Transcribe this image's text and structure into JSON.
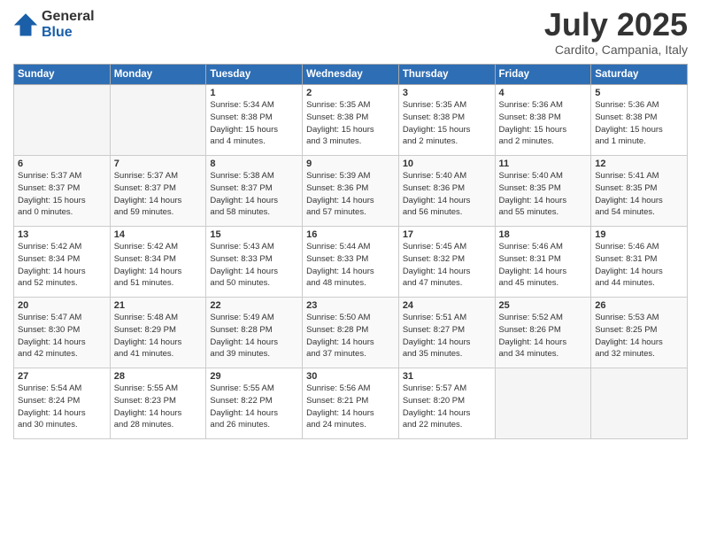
{
  "logo": {
    "general": "General",
    "blue": "Blue"
  },
  "title": "July 2025",
  "location": "Cardito, Campania, Italy",
  "weekdays": [
    "Sunday",
    "Monday",
    "Tuesday",
    "Wednesday",
    "Thursday",
    "Friday",
    "Saturday"
  ],
  "weeks": [
    [
      {
        "day": "",
        "info": ""
      },
      {
        "day": "",
        "info": ""
      },
      {
        "day": "1",
        "info": "Sunrise: 5:34 AM\nSunset: 8:38 PM\nDaylight: 15 hours\nand 4 minutes."
      },
      {
        "day": "2",
        "info": "Sunrise: 5:35 AM\nSunset: 8:38 PM\nDaylight: 15 hours\nand 3 minutes."
      },
      {
        "day": "3",
        "info": "Sunrise: 5:35 AM\nSunset: 8:38 PM\nDaylight: 15 hours\nand 2 minutes."
      },
      {
        "day": "4",
        "info": "Sunrise: 5:36 AM\nSunset: 8:38 PM\nDaylight: 15 hours\nand 2 minutes."
      },
      {
        "day": "5",
        "info": "Sunrise: 5:36 AM\nSunset: 8:38 PM\nDaylight: 15 hours\nand 1 minute."
      }
    ],
    [
      {
        "day": "6",
        "info": "Sunrise: 5:37 AM\nSunset: 8:37 PM\nDaylight: 15 hours\nand 0 minutes."
      },
      {
        "day": "7",
        "info": "Sunrise: 5:37 AM\nSunset: 8:37 PM\nDaylight: 14 hours\nand 59 minutes."
      },
      {
        "day": "8",
        "info": "Sunrise: 5:38 AM\nSunset: 8:37 PM\nDaylight: 14 hours\nand 58 minutes."
      },
      {
        "day": "9",
        "info": "Sunrise: 5:39 AM\nSunset: 8:36 PM\nDaylight: 14 hours\nand 57 minutes."
      },
      {
        "day": "10",
        "info": "Sunrise: 5:40 AM\nSunset: 8:36 PM\nDaylight: 14 hours\nand 56 minutes."
      },
      {
        "day": "11",
        "info": "Sunrise: 5:40 AM\nSunset: 8:35 PM\nDaylight: 14 hours\nand 55 minutes."
      },
      {
        "day": "12",
        "info": "Sunrise: 5:41 AM\nSunset: 8:35 PM\nDaylight: 14 hours\nand 54 minutes."
      }
    ],
    [
      {
        "day": "13",
        "info": "Sunrise: 5:42 AM\nSunset: 8:34 PM\nDaylight: 14 hours\nand 52 minutes."
      },
      {
        "day": "14",
        "info": "Sunrise: 5:42 AM\nSunset: 8:34 PM\nDaylight: 14 hours\nand 51 minutes."
      },
      {
        "day": "15",
        "info": "Sunrise: 5:43 AM\nSunset: 8:33 PM\nDaylight: 14 hours\nand 50 minutes."
      },
      {
        "day": "16",
        "info": "Sunrise: 5:44 AM\nSunset: 8:33 PM\nDaylight: 14 hours\nand 48 minutes."
      },
      {
        "day": "17",
        "info": "Sunrise: 5:45 AM\nSunset: 8:32 PM\nDaylight: 14 hours\nand 47 minutes."
      },
      {
        "day": "18",
        "info": "Sunrise: 5:46 AM\nSunset: 8:31 PM\nDaylight: 14 hours\nand 45 minutes."
      },
      {
        "day": "19",
        "info": "Sunrise: 5:46 AM\nSunset: 8:31 PM\nDaylight: 14 hours\nand 44 minutes."
      }
    ],
    [
      {
        "day": "20",
        "info": "Sunrise: 5:47 AM\nSunset: 8:30 PM\nDaylight: 14 hours\nand 42 minutes."
      },
      {
        "day": "21",
        "info": "Sunrise: 5:48 AM\nSunset: 8:29 PM\nDaylight: 14 hours\nand 41 minutes."
      },
      {
        "day": "22",
        "info": "Sunrise: 5:49 AM\nSunset: 8:28 PM\nDaylight: 14 hours\nand 39 minutes."
      },
      {
        "day": "23",
        "info": "Sunrise: 5:50 AM\nSunset: 8:28 PM\nDaylight: 14 hours\nand 37 minutes."
      },
      {
        "day": "24",
        "info": "Sunrise: 5:51 AM\nSunset: 8:27 PM\nDaylight: 14 hours\nand 35 minutes."
      },
      {
        "day": "25",
        "info": "Sunrise: 5:52 AM\nSunset: 8:26 PM\nDaylight: 14 hours\nand 34 minutes."
      },
      {
        "day": "26",
        "info": "Sunrise: 5:53 AM\nSunset: 8:25 PM\nDaylight: 14 hours\nand 32 minutes."
      }
    ],
    [
      {
        "day": "27",
        "info": "Sunrise: 5:54 AM\nSunset: 8:24 PM\nDaylight: 14 hours\nand 30 minutes."
      },
      {
        "day": "28",
        "info": "Sunrise: 5:55 AM\nSunset: 8:23 PM\nDaylight: 14 hours\nand 28 minutes."
      },
      {
        "day": "29",
        "info": "Sunrise: 5:55 AM\nSunset: 8:22 PM\nDaylight: 14 hours\nand 26 minutes."
      },
      {
        "day": "30",
        "info": "Sunrise: 5:56 AM\nSunset: 8:21 PM\nDaylight: 14 hours\nand 24 minutes."
      },
      {
        "day": "31",
        "info": "Sunrise: 5:57 AM\nSunset: 8:20 PM\nDaylight: 14 hours\nand 22 minutes."
      },
      {
        "day": "",
        "info": ""
      },
      {
        "day": "",
        "info": ""
      }
    ]
  ]
}
